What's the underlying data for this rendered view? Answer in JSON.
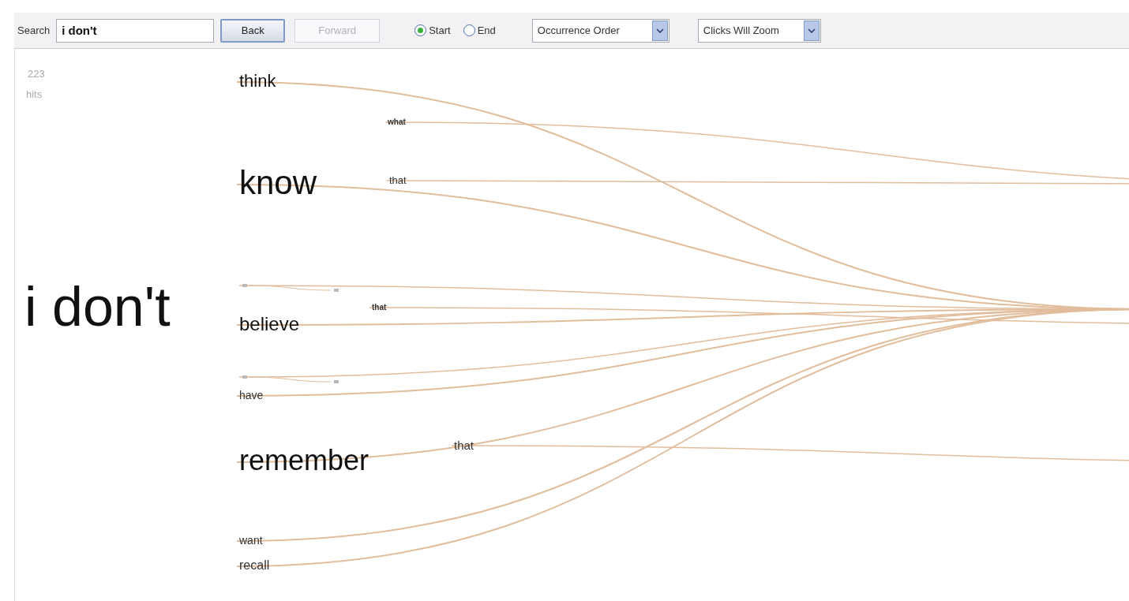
{
  "toolbar": {
    "search_label": "Search",
    "search_value": "i don't",
    "buttons": [
      {
        "label": "Back",
        "disabled": false
      },
      {
        "label": "Forward",
        "disabled": true
      }
    ],
    "anchor": [
      {
        "label": "Start",
        "selected": true
      },
      {
        "label": "End",
        "selected": false
      }
    ],
    "dropdowns": [
      "Occurrence Order",
      "Clicks Will Zoom"
    ]
  },
  "hits": {
    "count": "223",
    "label": "hits"
  },
  "tree": {
    "text": "i don't",
    "children": [
      {
        "text": "think"
      },
      {
        "text": "know",
        "children": [
          {
            "text": "what"
          },
          {
            "text": "that"
          }
        ]
      },
      {
        "text": "believe",
        "children": [
          {
            "text": "that"
          }
        ]
      },
      {
        "text": "have"
      },
      {
        "text": "remember",
        "children": [
          {
            "text": "that"
          }
        ]
      },
      {
        "text": "want"
      },
      {
        "text": "recall"
      }
    ]
  }
}
